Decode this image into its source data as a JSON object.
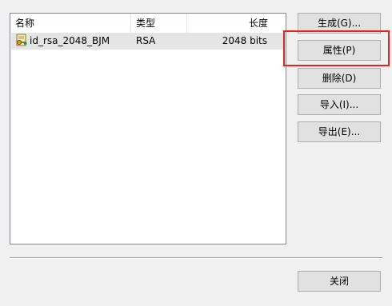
{
  "key_list": {
    "columns": {
      "name": "名称",
      "type": "类型",
      "length": "长度"
    },
    "rows": [
      {
        "icon": "key-icon",
        "name": "id_rsa_2048_BJM",
        "type": "RSA",
        "length": "2048 bits"
      }
    ]
  },
  "buttons": {
    "generate": "生成(G)...",
    "properties": "属性(P)",
    "delete": "删除(D)",
    "import": "导入(I)...",
    "export": "导出(E)...",
    "close": "关闭"
  },
  "highlight": {
    "target": "properties",
    "color": "#e8231c"
  }
}
